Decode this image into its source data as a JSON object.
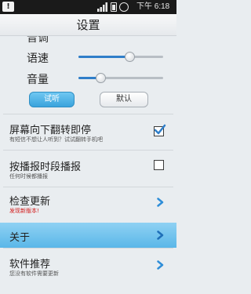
{
  "statusbar": {
    "warning": "!",
    "time": "下午 6:18"
  },
  "title": "设置",
  "clipped_label": "音调",
  "sliders": [
    {
      "label": "语速",
      "value": 0.61
    },
    {
      "label": "音量",
      "value": 0.27
    }
  ],
  "buttons": {
    "test": "试听",
    "default": "默认"
  },
  "rows": [
    {
      "title": "屏幕向下翻转即停",
      "subtitle": "有短信不想让人听到？试试翻转手机吧",
      "checked": true
    },
    {
      "title": "按播报时段播报",
      "subtitle": "任何时候都播报",
      "checked": false
    },
    {
      "title": "检查更新",
      "subtitle": "发现新版本!"
    },
    {
      "title": "关于"
    },
    {
      "title": "软件推荐",
      "subtitle": "您没有软件需要更新"
    }
  ],
  "colors": {
    "accent": "#3aa3dc",
    "selected_row": "#6cc0ec",
    "alert_text": "#d21a1a"
  },
  "icons": [
    "warning-icon",
    "signal-icon",
    "battery-icon",
    "alarm-clock-icon",
    "checkmark-icon",
    "chevron-right-icon"
  ]
}
